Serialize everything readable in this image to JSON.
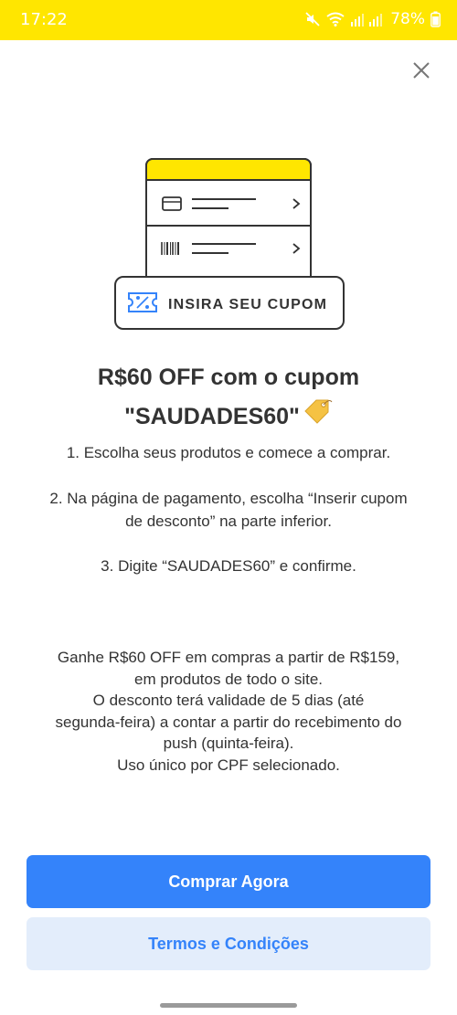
{
  "status_bar": {
    "time": "17:22",
    "battery": "78%"
  },
  "illustration": {
    "coupon_label": "INSIRA SEU CUPOM"
  },
  "offer": {
    "title_line1": "R$60 OFF com o cupom",
    "title_line2": "\"SAUDADES60\""
  },
  "steps": [
    "1. Escolha seus produtos e comece a comprar.",
    "2. Na página de pagamento, escolha “Inserir cupom",
    "de desconto” na parte inferior.",
    "3. Digite “SAUDADES60” e confirme."
  ],
  "description": [
    "Ganhe R$60 OFF em compras a partir de R$159,",
    "em produtos de todo o site.",
    "O desconto terá validade de 5 dias (até",
    "segunda-feira) a contar a partir do recebimento do",
    "push (quinta-feira).",
    "Uso único por CPF selecionado."
  ],
  "buttons": {
    "primary": "Comprar Agora",
    "secondary": "Termos e Condições"
  },
  "colors": {
    "status_bar": "#ffe600",
    "primary": "#3483fa",
    "secondary_bg": "#e3edfb"
  },
  "icons": [
    "mute-icon",
    "wifi-icon",
    "signal-icon",
    "battery-icon",
    "close-icon",
    "card-icon",
    "barcode-icon",
    "chevron-right-icon",
    "coupon-icon",
    "tag-icon"
  ]
}
